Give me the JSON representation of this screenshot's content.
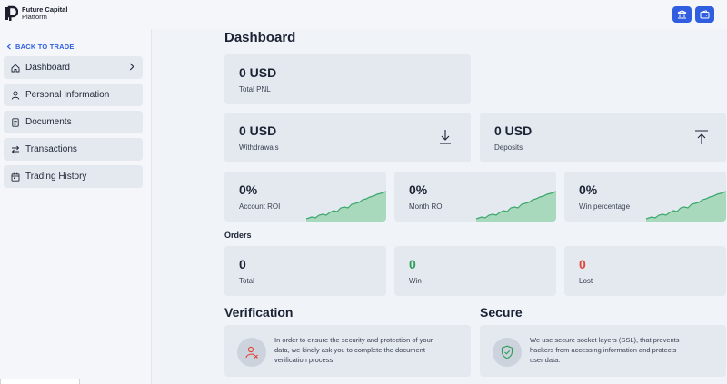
{
  "brand": {
    "line1": "Future Capital",
    "line2": "Platform"
  },
  "sidebar": {
    "back_label": "BACK TO TRADE",
    "items": [
      {
        "label": "Dashboard",
        "icon": "home-icon"
      },
      {
        "label": "Personal Information",
        "icon": "user-icon"
      },
      {
        "label": "Documents",
        "icon": "document-icon"
      },
      {
        "label": "Transactions",
        "icon": "transfer-icon"
      },
      {
        "label": "Trading History",
        "icon": "calendar-icon"
      }
    ]
  },
  "main": {
    "title": "Dashboard",
    "total_pnl": {
      "value": "0 USD",
      "label": "Total PNL"
    },
    "withdrawals": {
      "value": "0 USD",
      "label": "Withdrawals",
      "icon": "download-icon"
    },
    "deposits": {
      "value": "0 USD",
      "label": "Deposits",
      "icon": "upload-icon"
    },
    "stats": [
      {
        "value": "0%",
        "label": "Account ROI"
      },
      {
        "value": "0%",
        "label": "Month ROI"
      },
      {
        "value": "0%",
        "label": "Win percentage"
      }
    ],
    "orders_label": "Orders",
    "orders": [
      {
        "value": "0",
        "label": "Total",
        "color": "#1a2233"
      },
      {
        "value": "0",
        "label": "Win",
        "color": "#2e9e5b"
      },
      {
        "value": "0",
        "label": "Lost",
        "color": "#e0453a"
      }
    ],
    "verification": {
      "title": "Verification",
      "text_lines": [
        "In order to ensure the security and protection of your",
        "data, we kindly ask you to complete the document",
        "verification process"
      ]
    },
    "secure": {
      "title": "Secure",
      "text_lines": [
        "We use secure socket layers (SSL), that prevents",
        "hackers from accessing information and protects",
        "user data."
      ]
    }
  },
  "colors": {
    "accent": "#2f5fe0",
    "spark_fill": "#a9d9bd",
    "spark_line": "#3aa76b",
    "win": "#2e9e5b",
    "lost": "#e0453a"
  }
}
